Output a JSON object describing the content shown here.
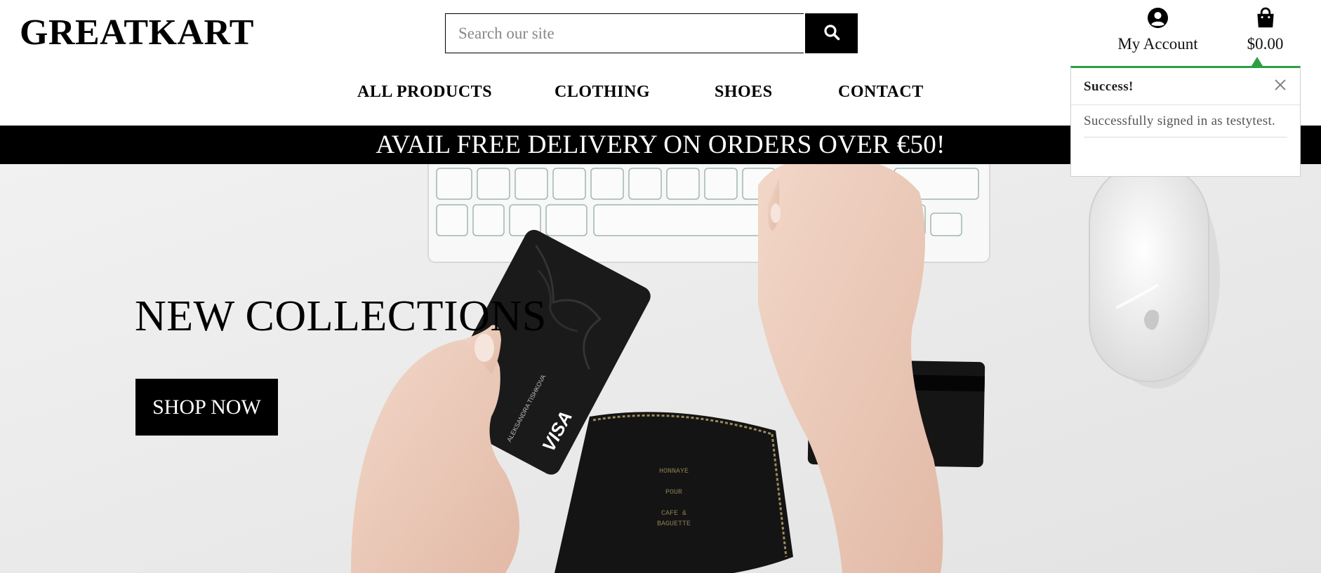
{
  "header": {
    "logo": "GREATKART",
    "search": {
      "placeholder": "Search our site",
      "value": ""
    },
    "account_label": "My Account",
    "cart_total": "$0.00"
  },
  "nav": {
    "items": [
      {
        "label": "ALL PRODUCTS"
      },
      {
        "label": "CLOTHING"
      },
      {
        "label": "SHOES"
      },
      {
        "label": "CONTACT"
      }
    ]
  },
  "banner": {
    "text": "AVAIL FREE DELIVERY ON ORDERS OVER €50!"
  },
  "hero": {
    "title": "NEW COLLECTIONS",
    "cta_label": "SHOP NOW",
    "card_brand": "VISA",
    "card_holder": "ALEKSANDRA TISHKOVA"
  },
  "toast": {
    "title": "Success!",
    "message": "Successfully signed in as testytest."
  },
  "colors": {
    "accent_success": "#2e9e45",
    "primary": "#000000",
    "background": "#ffffff"
  },
  "icons": [
    "search-icon",
    "account-icon",
    "shopping-bag-icon",
    "close-icon"
  ]
}
